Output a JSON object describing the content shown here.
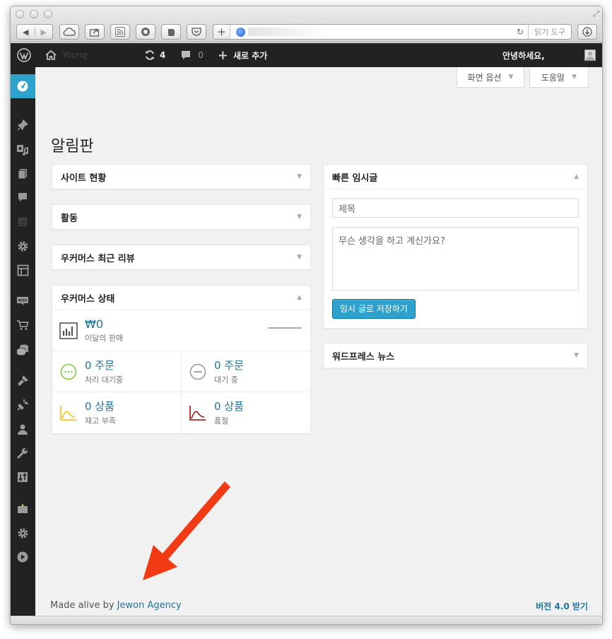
{
  "browser": {
    "reader_label": "읽기 도구"
  },
  "adminbar": {
    "site_name": "Young",
    "updates_count": "4",
    "comments_count": "0",
    "new_label": "새로 추가",
    "greeting": "안녕하세요,"
  },
  "screen_options": {
    "screen_label": "화면 옵션",
    "help_label": "도움말"
  },
  "page": {
    "title": "알림판"
  },
  "widgets": {
    "site_status": "사이트 현황",
    "activity": "활동",
    "wc_reviews": "우커머스 최근 리뷰",
    "wc_status": "우커머스 상태",
    "quick_draft": "빠른 임시글",
    "wp_news": "워드프레스 뉴스"
  },
  "wc_status": {
    "sales_value": "₩0",
    "sales_label": "이달의 판매",
    "processing_value": "0 주문",
    "processing_label": "처리 대기중",
    "onhold_value": "0 주문",
    "onhold_label": "대기 중",
    "lowstock_value": "0 상품",
    "lowstock_label": "재고 부족",
    "outofstock_value": "0 상품",
    "outofstock_label": "품절"
  },
  "quick_draft": {
    "title_placeholder": "제목",
    "content_placeholder": "무슨 생각을 하고 계신가요?",
    "save_label": "임시 글로 저장하기"
  },
  "footer": {
    "made_alive_prefix": "Made alive by",
    "agency_link": "Jewon Agency",
    "version_link": "버전 4.0 받기"
  },
  "colors": {
    "admin_bar": "#222222",
    "accent": "#2ea2cc",
    "link": "#21759b",
    "annotation_arrow": "#f23a15"
  }
}
